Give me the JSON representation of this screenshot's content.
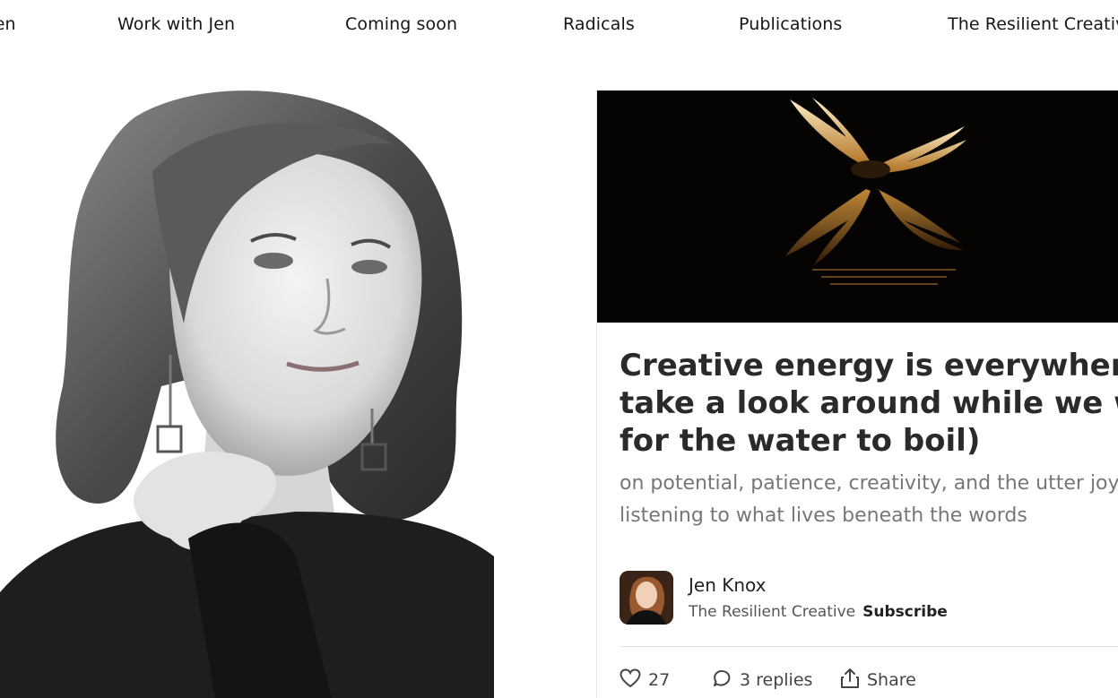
{
  "nav": {
    "items": [
      {
        "label": "Jen"
      },
      {
        "label": "Work with Jen"
      },
      {
        "label": "Coming soon"
      },
      {
        "label": "Radicals"
      },
      {
        "label": "Publications"
      },
      {
        "label": "The Resilient Creative"
      }
    ]
  },
  "post": {
    "title_lines": [
      "Creative energy is everywhere (let's",
      "take a look around while we wait",
      "for the water to boil)"
    ],
    "subtitle_lines": [
      "on potential, patience, creativity, and the utter joy of",
      "listening to what lives beneath the words"
    ],
    "author": {
      "name": "Jen Knox",
      "publication": "The Resilient Creative",
      "subscribe_label": "Subscribe"
    },
    "stats": {
      "likes": "27",
      "replies": "3 replies",
      "share_label": "Share"
    }
  },
  "colors": {
    "text": "#1f1f1f",
    "muted": "#777777",
    "hero_background": "#050403",
    "hero_glow": "#e8b060"
  },
  "icons": [
    "heart-icon",
    "comment-icon",
    "share-icon"
  ]
}
